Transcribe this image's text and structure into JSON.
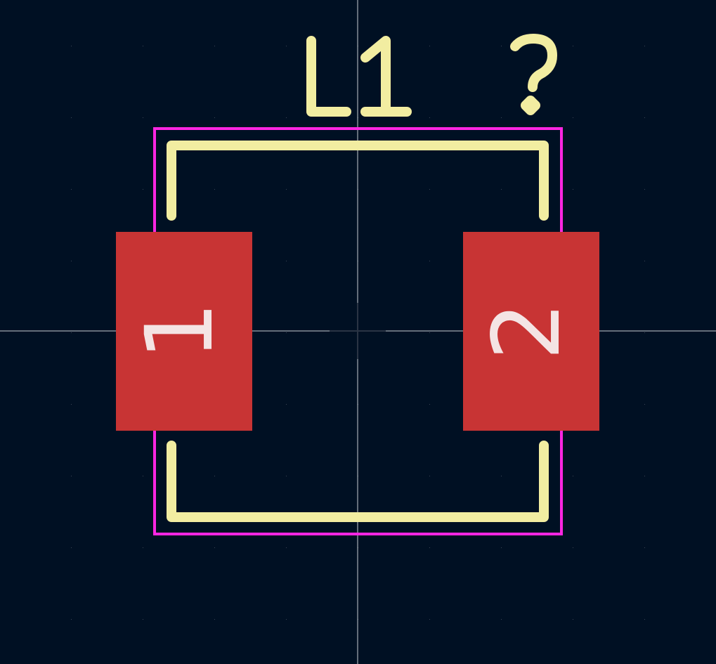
{
  "footprint": {
    "reference": "L1",
    "value": "?",
    "pads": [
      {
        "number": "1"
      },
      {
        "number": "2"
      }
    ]
  },
  "colors": {
    "background": "#001023",
    "grid": "#3a4656",
    "crosshair": "#c9ccd1",
    "silkscreen": "#f2eda1",
    "courtyard": "#ff26e2",
    "pad": "#c83434",
    "pad_label": "#f4e4e4"
  }
}
